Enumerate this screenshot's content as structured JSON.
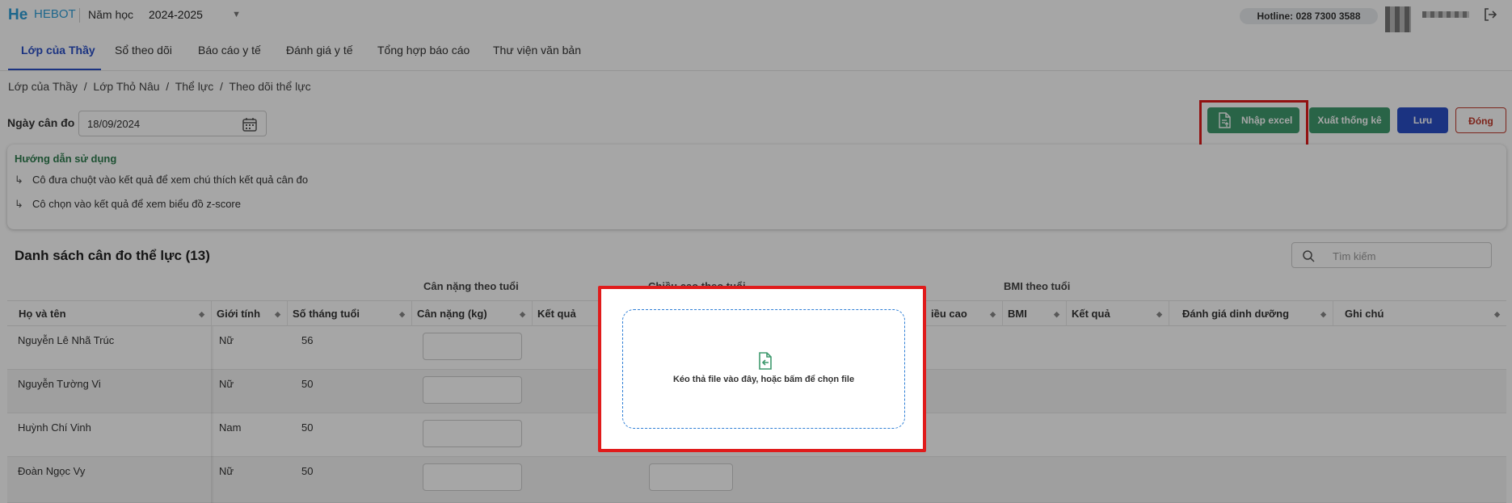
{
  "header": {
    "logo_text": "He",
    "brand": "HEBOT",
    "year_label": "Năm học",
    "year_value": "2024-2025",
    "hotline": "Hotline: 028 7300 3588"
  },
  "tabs": [
    {
      "label": "Lớp của Thầy"
    },
    {
      "label": "Sổ theo dõi"
    },
    {
      "label": "Báo cáo y tế"
    },
    {
      "label": "Đánh giá y tế"
    },
    {
      "label": "Tổng hợp báo cáo"
    },
    {
      "label": "Thư viện văn bản"
    }
  ],
  "breadcrumb": "Lớp của Thầy  /  Lớp Thỏ Nâu  /  Thể lực  /  Theo dõi thể lực",
  "date": {
    "label": "Ngày cân đo",
    "value": "18/09/2024"
  },
  "buttons": {
    "import": "Nhập excel",
    "export": "Xuất thống kê",
    "save": "Lưu",
    "close": "Đóng"
  },
  "guide": {
    "title": "Hướng dẫn sử dụng",
    "items": [
      "Cô đưa chuột vào kết quả để xem chú thích kết quả cân đo",
      "Cô chọn vào kết quả để xem biểu đồ z-score"
    ]
  },
  "list": {
    "title": "Danh sách cân đo thể lực (13)",
    "search_placeholder": "Tìm kiếm"
  },
  "table": {
    "groups": {
      "weight": "Cân nặng theo tuổi",
      "height": "Chiều cao theo tuổi",
      "bmi": "BMI theo tuổi"
    },
    "columns": {
      "name": "Họ và tên",
      "gender": "Giới tính",
      "age_months": "Số tháng tuổi",
      "weight": "Cân nặng (kg)",
      "weight_result": "Kết quả",
      "height_partial": "iều cao",
      "bmi": "BMI",
      "bmi_result": "Kết quả",
      "nutrition": "Đánh giá dinh dưỡng",
      "note": "Ghi chú"
    },
    "rows": [
      {
        "name": "Nguyễn Lê Nhã Trúc",
        "gender": "Nữ",
        "age": "56"
      },
      {
        "name": "Nguyễn Tường Vi",
        "gender": "Nữ",
        "age": "50"
      },
      {
        "name": "Huỳnh Chí Vinh",
        "gender": "Nam",
        "age": "50"
      },
      {
        "name": "Đoàn Ngọc Vy",
        "gender": "Nữ",
        "age": "50"
      }
    ]
  },
  "upload_modal": {
    "text": "Kéo thả file vào đây, hoặc bấm để chọn file"
  },
  "colors": {
    "primary": "#2a4fc7",
    "success": "#3f9a6e",
    "danger": "#c0392b",
    "highlight": "#e01b1b"
  }
}
